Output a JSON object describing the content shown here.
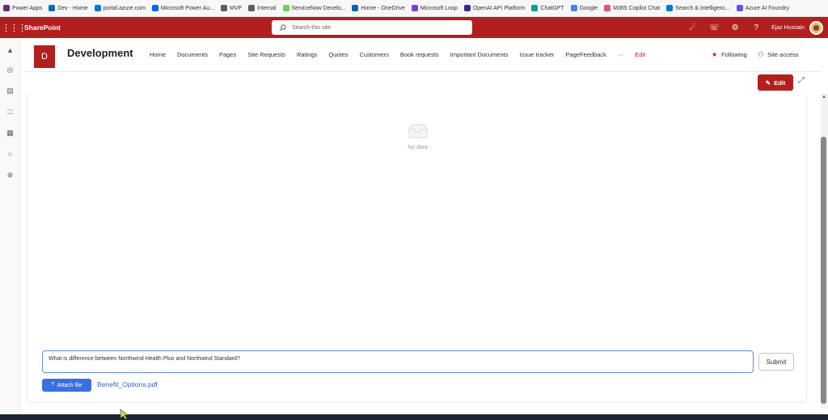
{
  "bookmarks": [
    {
      "label": "Power Apps",
      "color": "#742774"
    },
    {
      "label": "Dev - Home",
      "color": "#0f6cbd"
    },
    {
      "label": "portal.azure.com",
      "color": "#0078d4"
    },
    {
      "label": "Microsoft Power Au...",
      "color": "#0066ff"
    },
    {
      "label": "MVP",
      "color": "#605e5c"
    },
    {
      "label": "Internal",
      "color": "#605e5c"
    },
    {
      "label": "ServiceNow Develo...",
      "color": "#62d84e"
    },
    {
      "label": "Home - OneDrive",
      "color": "#0364b8"
    },
    {
      "label": "Microsoft Loop",
      "color": "#7b3fe4"
    },
    {
      "label": "OpenAI API Platform",
      "color": "#412991"
    },
    {
      "label": "ChatGPT",
      "color": "#10a37f"
    },
    {
      "label": "Google",
      "color": "#4285f4"
    },
    {
      "label": "M365 Copilot Chat",
      "color": "#e74c8b"
    },
    {
      "label": "Search & intelligenc...",
      "color": "#0078d4"
    },
    {
      "label": "Azure AI Foundry",
      "color": "#6a4cf0"
    }
  ],
  "topbar": {
    "brand": "SharePoint",
    "search_placeholder": "Search this site",
    "user_name": "Ejaz Hussain",
    "accent": "#b21f1f"
  },
  "site": {
    "logo_letter": "D",
    "title": "Development",
    "nav": [
      "Home",
      "Documents",
      "Pages",
      "Site Requests",
      "Ratings",
      "Quotes",
      "Customers",
      "Book requests",
      "Important Documents",
      "Issue tracker",
      "PageFeedback",
      "···"
    ],
    "nav_edit": "Edit",
    "following": "Following",
    "site_access": "Site access"
  },
  "command": {
    "edit_label": "Edit"
  },
  "content": {
    "empty_text": "No data",
    "prompt_value": "What is difference between Northwind Health Plus and Northwind Standard?",
    "submit_label": "Submit",
    "attach_label": "Attach file",
    "attached_file": "Benefit_Options.pdf"
  }
}
